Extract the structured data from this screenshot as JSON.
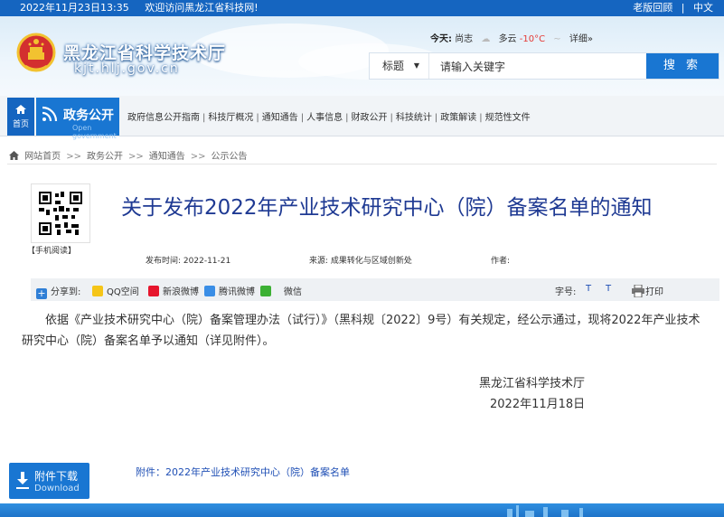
{
  "topbar": {
    "datetime": "2022年11月23日13:35",
    "welcome": "欢迎访问黑龙江省科技网!",
    "old_version": "老版回顾",
    "separator": "|",
    "chinese": "中文"
  },
  "header": {
    "site_title": "黑龙江省科学技术厅",
    "site_domain": "kjt.hlj.gov.cn",
    "weather": {
      "label": "今天:",
      "city": "尚志",
      "condition": "多云",
      "temp": "-10°C",
      "temp_sep": "~",
      "detail": "详细»"
    },
    "search": {
      "category": "标题",
      "placeholder": "请输入关键字",
      "button": "搜 索"
    }
  },
  "nav": {
    "home_label": "首页",
    "gov_label": "政务公开",
    "gov_sub": "Open government",
    "links": [
      "政府信息公开指南",
      "科技厅概况",
      "通知通告",
      "人事信息",
      "财政公开",
      "科技统计",
      "政策解读",
      "规范性文件"
    ],
    "link_sep": "|"
  },
  "breadcrumb": {
    "items": [
      "网站首页",
      "政务公开",
      "通知通告",
      "公示公告"
    ],
    "sep": ">>"
  },
  "article": {
    "qr_label": "【手机阅读】",
    "title": "关于发布2022年产业技术研究中心（院）备案名单的通知",
    "publish_label": "发布时间:",
    "publish_date": "2022-11-21",
    "source_label": "来源:",
    "source": "成果转化与区域创新处",
    "author_label": "作者:",
    "body": "依据《产业技术研究中心（院）备案管理办法（试行）》（黑科规〔2022〕9号）有关规定，经公示通过，现将2022年产业技术研究中心（院）备案名单予以通知（详见附件）。",
    "sign_org": "黑龙江省科学技术厅",
    "sign_date": "2022年11月18日",
    "attachment": "附件：2022年产业技术研究中心（院）备案名单"
  },
  "share": {
    "label": "分享到:",
    "qq": "QQ空间",
    "sina": "新浪微博",
    "tencent": "腾讯微博",
    "wechat": "微信",
    "font_label": "字号:",
    "font_large": "T",
    "font_small": "T",
    "print": "打印"
  },
  "download": {
    "label": "附件下载",
    "sub": "Download"
  },
  "colors": {
    "brand_blue": "#1976d2",
    "title_blue": "#1f3a93",
    "temp_red": "#e53935"
  }
}
